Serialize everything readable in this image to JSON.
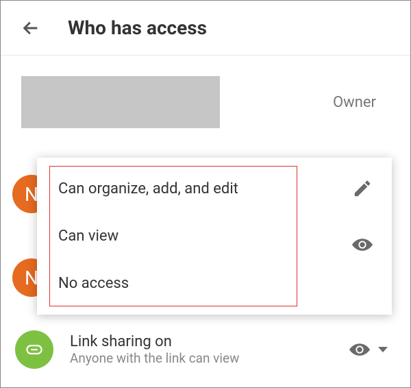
{
  "header": {
    "title": "Who has access"
  },
  "owner": {
    "role_label": "Owner"
  },
  "avatars": {
    "a1_letter": "N",
    "a2_letter": "N"
  },
  "popup": {
    "options": {
      "edit": "Can organize, add, and edit",
      "view": "Can view",
      "none": "No access"
    }
  },
  "link_sharing": {
    "title": "Link sharing on",
    "subtitle": "Anyone with the link can view"
  },
  "icons": {
    "back": "back-arrow-icon",
    "pencil": "pencil-icon",
    "eye": "eye-icon",
    "link": "link-icon",
    "caret": "caret-down-icon"
  }
}
